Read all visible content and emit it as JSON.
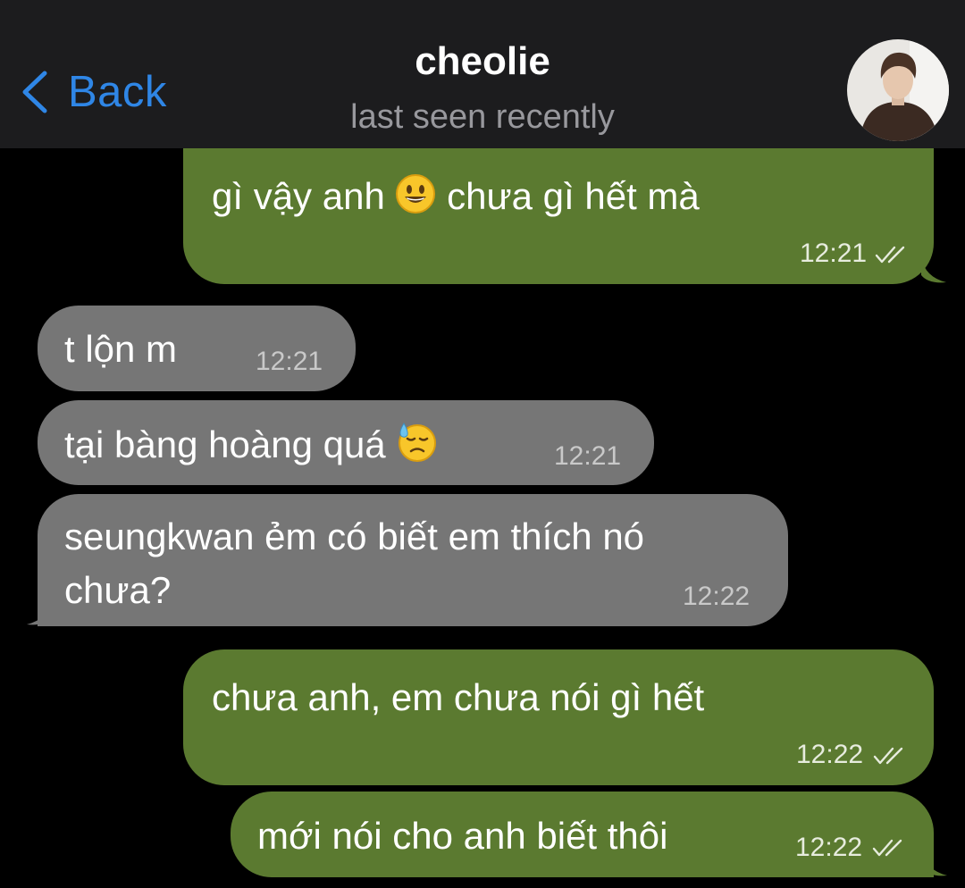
{
  "header": {
    "back_label": "Back",
    "contact_name": "cheolie",
    "status": "last seen recently"
  },
  "messages": [
    {
      "direction": "outgoing",
      "text_before": "gì vậy anh",
      "emoji": "grinning-face-icon",
      "text_after": "chưa gì hết mà",
      "time": "12:21",
      "read": true
    },
    {
      "direction": "incoming",
      "text": "t lộn m",
      "time": "12:21"
    },
    {
      "direction": "incoming",
      "text": "tại bàng hoàng quá",
      "emoji": "downcast-sweat-face-icon",
      "time": "12:21"
    },
    {
      "direction": "incoming",
      "lines": [
        "seungkwan ẻm có biết em thích nó",
        "chưa?"
      ],
      "time": "12:22"
    },
    {
      "direction": "outgoing",
      "text": "chưa anh, em chưa nói gì hết",
      "time": "12:22",
      "read": true
    },
    {
      "direction": "outgoing",
      "text": "mới nói cho anh biết thôi",
      "time": "12:22",
      "read": true
    }
  ],
  "colors": {
    "outgoing_bubble": "#5b7a30",
    "incoming_bubble": "#767676",
    "accent": "#2f86e6",
    "header_bg": "#1c1c1e",
    "background": "#000000"
  }
}
